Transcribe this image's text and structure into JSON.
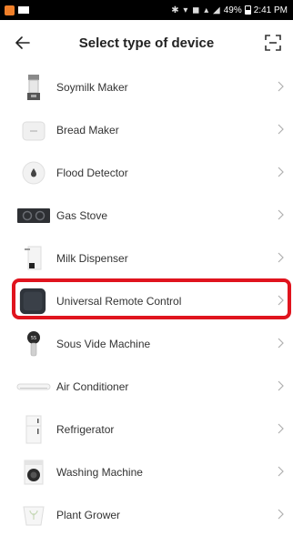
{
  "status_bar": {
    "battery": "49%",
    "time": "2:41 PM"
  },
  "header": {
    "title": "Select type of device",
    "back_icon": "arrow-left-icon",
    "scan_icon": "scan-icon"
  },
  "devices": [
    {
      "label": "Soymilk Maker",
      "icon": "soymilk-maker-icon"
    },
    {
      "label": "Bread Maker",
      "icon": "bread-maker-icon"
    },
    {
      "label": "Flood Detector",
      "icon": "flood-detector-icon"
    },
    {
      "label": "Gas Stove",
      "icon": "gas-stove-icon"
    },
    {
      "label": "Milk Dispenser",
      "icon": "milk-dispenser-icon"
    },
    {
      "label": "Universal Remote Control",
      "icon": "remote-control-icon"
    },
    {
      "label": "Sous Vide Machine",
      "icon": "sous-vide-icon"
    },
    {
      "label": "Air Conditioner",
      "icon": "air-conditioner-icon"
    },
    {
      "label": "Refrigerator",
      "icon": "refrigerator-icon"
    },
    {
      "label": "Washing Machine",
      "icon": "washing-machine-icon"
    },
    {
      "label": "Plant Grower",
      "icon": "plant-grower-icon"
    }
  ],
  "colors": {
    "highlight": "#e0141e",
    "chevron": "#b0b0b0",
    "status_bar_bg": "#000000"
  }
}
